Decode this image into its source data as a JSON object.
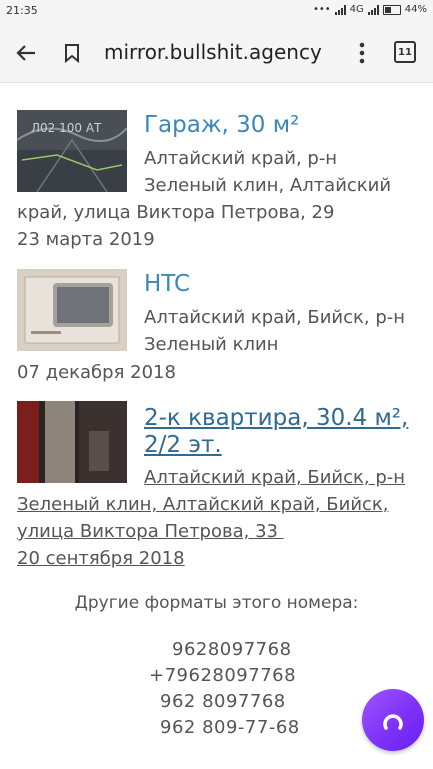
{
  "status_bar": {
    "time": "21:35",
    "network": "4G",
    "battery": "44%"
  },
  "toolbar": {
    "url": "mirror.bullshit.agency",
    "tab_count": "11"
  },
  "listings": [
    {
      "title": "Гараж, 30 м²",
      "lines": [
        "Алтайский край, р-н",
        "Зеленый клин, Алтайский",
        "край, улица Виктора Петрова, 29"
      ],
      "date": "23 марта 2019",
      "underlined": false
    },
    {
      "title": "HTC",
      "lines": [
        "Алтайский край, Бийск, р-н",
        "Зеленый клин"
      ],
      "date": "07 декабря 2018",
      "underlined": false
    },
    {
      "title_lines": [
        "2-к квартира, 30.4 м²,",
        "2/2 эт."
      ],
      "lines": [
        "Алтайский край, Бийск, р-н",
        "Зеленый клин, Алтайский край, Бийск,",
        "улица Виктора Петрова, 33 "
      ],
      "date": "20 сентября 2018",
      "underlined": true
    }
  ],
  "formats": {
    "heading": "Другие форматы этого номера:",
    "phones": [
      "9628097768",
      "+79628097768",
      "962 8097768",
      "962 809-77-68"
    ]
  },
  "colors": {
    "link": "#3d86b6",
    "visited_link": "#2f6a93",
    "assistant": "#8a3ffc"
  }
}
